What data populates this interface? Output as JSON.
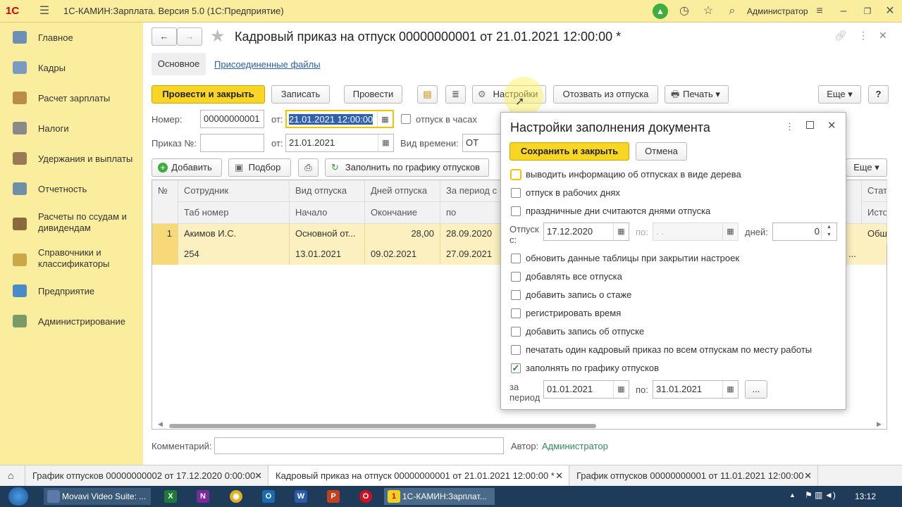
{
  "app": {
    "logo": "1С",
    "title": "1С-КАМИН:Зарплата. Версия 5.0  (1С:Предприятие)",
    "user": "Администратор"
  },
  "sidebar": {
    "items": [
      {
        "label": "Главное",
        "icon": "home-icon"
      },
      {
        "label": "Кадры",
        "icon": "people-icon"
      },
      {
        "label": "Расчет зарплаты",
        "icon": "calculator-icon"
      },
      {
        "label": "Налоги",
        "icon": "book-icon"
      },
      {
        "label": "Удержания и выплаты",
        "icon": "wallet-icon"
      },
      {
        "label": "Отчетность",
        "icon": "chart-icon"
      },
      {
        "label": "Расчеты по ссудам и\nдивидендам",
        "icon": "money-icon"
      },
      {
        "label": "Справочники и\nклассификаторы",
        "icon": "folder-icon"
      },
      {
        "label": "Предприятие",
        "icon": "building-icon"
      },
      {
        "label": "Администрирование",
        "icon": "gear-icon"
      }
    ]
  },
  "doc": {
    "title": "Кадровый приказ на отпуск 00000000001 от 21.01.2021 12:00:00 *",
    "tab_main": "Основное",
    "tab_files": "Присоединенные файлы",
    "toolbar": {
      "post_close": "Провести и закрыть",
      "save": "Записать",
      "post": "Провести",
      "settings": "Настройки",
      "recall": "Отозвать из отпуска",
      "print": "Печать",
      "more": "Еще",
      "help": "?"
    },
    "number_label": "Номер:",
    "number": "00000000001",
    "from_label": "от:",
    "date": "21.01.2021 12:00:00",
    "hours_label": "отпуск в часах",
    "order_label": "Приказ №:",
    "order": "",
    "order_from_label": "от:",
    "order_date": "21.01.2021",
    "time_kind_label": "Вид времени:",
    "time_kind": "ОТ",
    "grid_toolbar": {
      "add": "Добавить",
      "select": "Подбор",
      "fill": "Заполнить по графику отпусков",
      "more": "Еще"
    },
    "grid": {
      "headers1": [
        "№",
        "Сотрудник",
        "Вид отпуска",
        "Дней отпуска",
        "За период с",
        "Стат"
      ],
      "headers2": [
        "",
        "Таб номер",
        "Начало",
        "Окончание",
        "по",
        "Исто"
      ],
      "row1": [
        "1",
        "Акимов И.С.",
        "Основной от...",
        "28,00",
        "28.09.2020",
        "Общ"
      ],
      "row2": [
        "",
        "254",
        "13.01.2021",
        "09.02.2021",
        "27.09.2021",
        "..."
      ]
    },
    "comment_label": "Комментарий:",
    "comment": "",
    "author_label": "Автор:",
    "author": "Администратор"
  },
  "dialog": {
    "title": "Настройки заполнения документа",
    "save_close": "Сохранить и закрыть",
    "cancel": "Отмена",
    "options_top": [
      {
        "label": "выводить информацию об отпусках в виде дерева",
        "checked": false
      },
      {
        "label": "отпуск в рабочих днях",
        "checked": false
      },
      {
        "label": "праздничные дни считаются днями отпуска",
        "checked": false
      }
    ],
    "vac_from_label": "Отпуск с:",
    "vac_from": "17.12.2020",
    "vac_to_label": "по:",
    "vac_to": "  .  .",
    "days_label": "дней:",
    "days": "0",
    "options": [
      {
        "label": "обновить данные таблицы при закрытии настроек",
        "checked": false
      },
      {
        "label": "добавлять все отпуска",
        "checked": false
      },
      {
        "label": "добавить запись о стаже",
        "checked": false
      },
      {
        "label": "регистрировать время",
        "checked": false
      },
      {
        "label": "добавить запись об отпуске",
        "checked": false
      },
      {
        "label": "печатать один кадровый приказ по всем отпускам по месту работы",
        "checked": false
      },
      {
        "label": "заполнять по графику отпусков",
        "checked": true
      }
    ],
    "period_label": "за период",
    "period_from": "01.01.2021",
    "period_to_label": "по:",
    "period_to": "31.01.2021",
    "dots": "..."
  },
  "tabs": [
    {
      "label": "График отпусков 00000000002 от 17.12.2020 0:00:00"
    },
    {
      "label": "Кадровый приказ на отпуск 00000000001 от 21.01.2021 12:00:00 *"
    },
    {
      "label": "График отпусков 00000000001 от 11.01.2021 12:00:00"
    }
  ],
  "taskbar": {
    "movavi": "Movavi Video Suite: ...",
    "app": "1С-КАМИН:Зарплат...",
    "time": "13:12"
  }
}
